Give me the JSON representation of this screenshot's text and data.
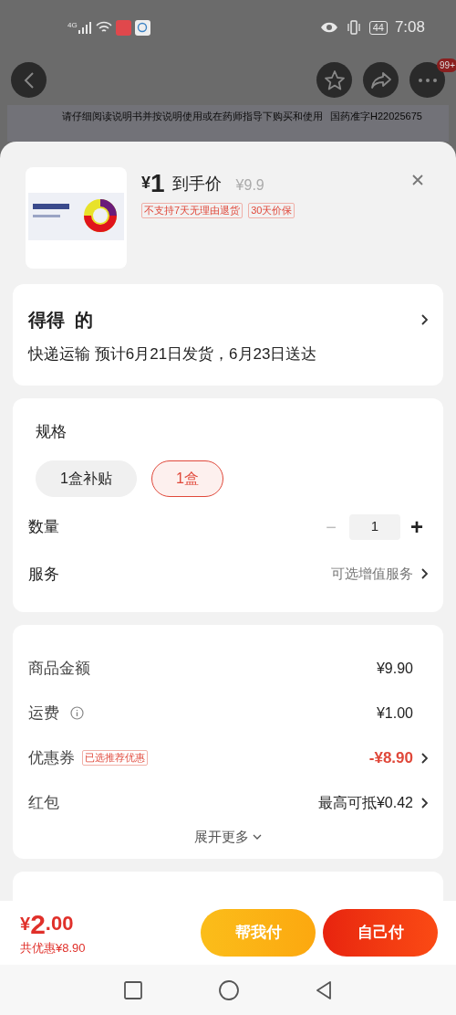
{
  "status_bar": {
    "network": "4G",
    "battery": "44",
    "time": "7:08"
  },
  "nav": {
    "badge": "99+"
  },
  "banner": {
    "notice": "请仔细阅读说明书并按说明使用或在药师指导下购买和使用",
    "approval": "国药准字H22025675"
  },
  "product": {
    "currency": "¥",
    "price": "1",
    "price_label": "到手价",
    "original_price": "¥9.9",
    "tags": [
      "不支持7天无理由退货",
      "30天价保"
    ]
  },
  "shipping": {
    "store": "得得  的",
    "delivery": "快递运输 预计6月21日发货，6月23日送达"
  },
  "spec": {
    "title": "规格",
    "options": [
      {
        "label": "1盒补贴",
        "selected": false
      },
      {
        "label": "1盒",
        "selected": true
      }
    ],
    "quantity_label": "数量",
    "quantity": "1",
    "minus": "−",
    "plus": "+",
    "service_label": "服务",
    "service_value": "可选增值服务"
  },
  "summary": [
    {
      "label": "商品金额",
      "value": "¥9.90",
      "kind": "plain",
      "arrow": false
    },
    {
      "label": "运费",
      "value": "¥1.00",
      "kind": "info",
      "arrow": false
    },
    {
      "label": "优惠券",
      "tag": "已选推荐优惠",
      "value": "-¥8.90",
      "kind": "discount",
      "arrow": true
    },
    {
      "label": "红包",
      "value": "最高可抵¥0.42",
      "kind": "plain",
      "arrow": true
    }
  ],
  "expand": "展开更多",
  "footer": {
    "currency": "¥",
    "total_int": "2",
    "total_dec": ".00",
    "saved": "共优惠¥8.90",
    "buttons": [
      "帮我付",
      "自己付"
    ]
  }
}
